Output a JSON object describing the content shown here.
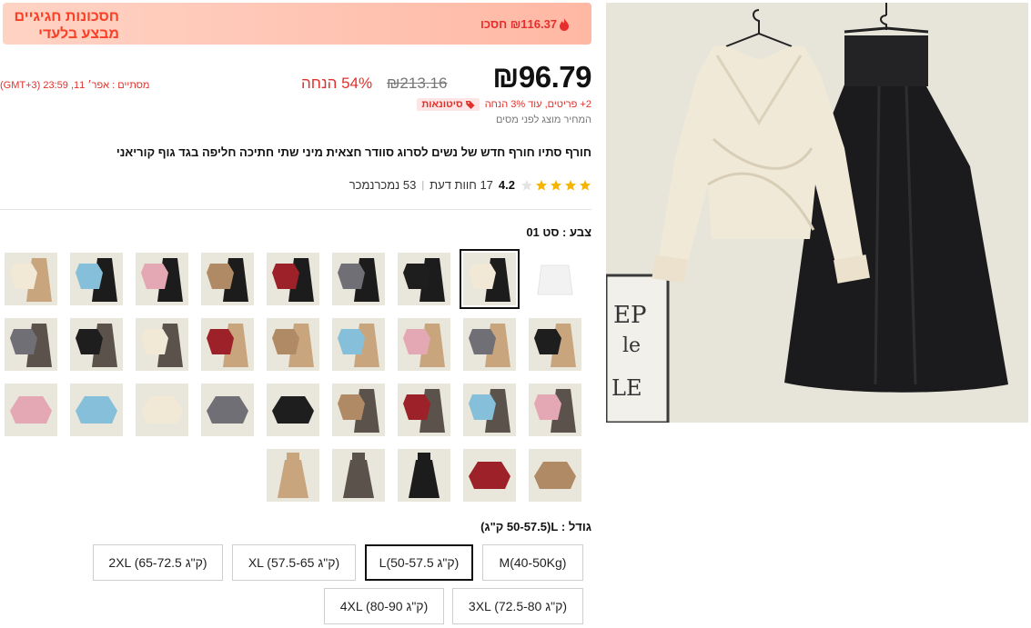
{
  "banner": {
    "title": "חסכונות חגיגיים מבצע בלעדי",
    "save_text": "₪116.37 חסכו"
  },
  "price": {
    "current": "₪96.79",
    "original": "₪213.16",
    "discount": "54% הנחה",
    "timer": "מסתיים : אפר׳ 11, 23:59 (GMT+3)",
    "wholesale_badge": "סיטונאות",
    "wholesale_text": "2+ פריטים, עוד 3% הנחה",
    "tax_note": "המחיר מוצג לפני מסים"
  },
  "product": {
    "title": "חורף סתיו חורף חדש של נשים לסרוג סוודר חצאית מיני שתי חתיכה חליפה בגד גוף קוריאני",
    "rating": "4.2",
    "reviews": "17 חוות דעת",
    "sold": "53 נמכרנמכר"
  },
  "color": {
    "label": "צבע : סט 01",
    "swatches": [
      {
        "top": "#f7f7f7",
        "bottom": "none",
        "kind": "white"
      },
      {
        "top": "#f1e8d6",
        "bottom": "#1c1c1c",
        "kind": "set"
      },
      {
        "top": "#1e1e1e",
        "bottom": "#1c1c1c",
        "kind": "set"
      },
      {
        "top": "#6f6f75",
        "bottom": "#1c1c1c",
        "kind": "set"
      },
      {
        "top": "#9c2128",
        "bottom": "#1c1c1c",
        "kind": "set"
      },
      {
        "top": "#b08a64",
        "bottom": "#1c1c1c",
        "kind": "set"
      },
      {
        "top": "#e4a8b4",
        "bottom": "#1c1c1c",
        "kind": "set"
      },
      {
        "top": "#86bfd9",
        "bottom": "#1c1c1c",
        "kind": "set"
      },
      {
        "top": "#f1e8d6",
        "bottom": "#c8a57c",
        "kind": "set"
      },
      {
        "top": "#1e1e1e",
        "bottom": "#c8a57c",
        "kind": "set"
      },
      {
        "top": "#6f6f75",
        "bottom": "#c8a57c",
        "kind": "set"
      },
      {
        "top": "#e4a8b4",
        "bottom": "#c8a57c",
        "kind": "set"
      },
      {
        "top": "#86bfd9",
        "bottom": "#c8a57c",
        "kind": "set"
      },
      {
        "top": "#b08a64",
        "bottom": "#c8a57c",
        "kind": "set"
      },
      {
        "top": "#9c2128",
        "bottom": "#c8a57c",
        "kind": "set"
      },
      {
        "top": "#f1e8d6",
        "bottom": "#5b524c",
        "kind": "set"
      },
      {
        "top": "#1e1e1e",
        "bottom": "#5b524c",
        "kind": "set"
      },
      {
        "top": "#6f6f75",
        "bottom": "#5b524c",
        "kind": "set"
      },
      {
        "top": "#e4a8b4",
        "bottom": "#5b524c",
        "kind": "set"
      },
      {
        "top": "#86bfd9",
        "bottom": "#5b524c",
        "kind": "set"
      },
      {
        "top": "#9c2128",
        "bottom": "#5b524c",
        "kind": "set"
      },
      {
        "top": "#b08a64",
        "bottom": "#5b524c",
        "kind": "set"
      },
      {
        "top": "#1e1e1e",
        "bottom": "none",
        "kind": "top"
      },
      {
        "top": "#6f6f75",
        "bottom": "none",
        "kind": "top"
      },
      {
        "top": "#f1e8d6",
        "bottom": "none",
        "kind": "top"
      },
      {
        "top": "#86bfd9",
        "bottom": "none",
        "kind": "top"
      },
      {
        "top": "#e4a8b4",
        "bottom": "none",
        "kind": "top"
      },
      {
        "top": "#b08a64",
        "bottom": "none",
        "kind": "top"
      },
      {
        "top": "#9c2128",
        "bottom": "none",
        "kind": "top"
      },
      {
        "top": "none",
        "bottom": "#1c1c1c",
        "kind": "skirt"
      },
      {
        "top": "none",
        "bottom": "#5b524c",
        "kind": "skirt"
      },
      {
        "top": "none",
        "bottom": "#c8a57c",
        "kind": "skirt"
      }
    ]
  },
  "size": {
    "label": "גודל : L(50-57.5 ק\"ג)",
    "options": [
      "M(40-50Kg)",
      "L(50-57.5 ק\"ג)",
      "XL (57.5-65 ק\"ג)",
      "2XL (65-72.5 ק\"ג)",
      "3XL (72.5-80 ק\"ג)",
      "4XL (80-90 ק\"ג)"
    ]
  },
  "colors": {
    "accent_red": "#e0302a",
    "banner_text": "#fa3f25",
    "star": "#f5b400"
  }
}
